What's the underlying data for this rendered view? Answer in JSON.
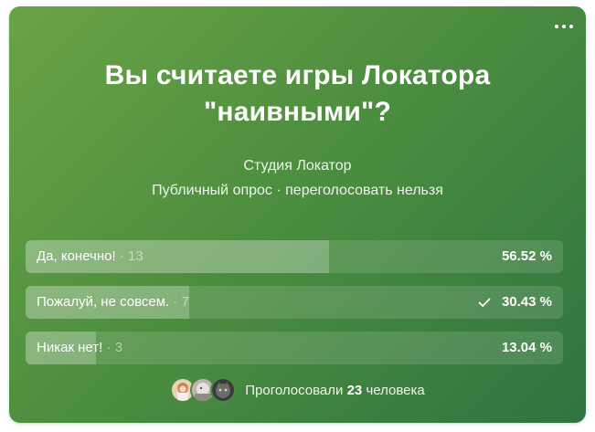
{
  "poll": {
    "title": "Вы считаете игры Локатора \"наивными\"?",
    "author": "Студия Локатор",
    "meta": "Публичный опрос · переголосовать нельзя",
    "menu_icon": "more-horizontal-icon",
    "answers": [
      {
        "label": "Да, конечно!",
        "count": "13",
        "percent_text": "56.52 %",
        "fill_fraction": 0.5652,
        "voted": false
      },
      {
        "label": "Пожалуй, не совсем.",
        "count": "7",
        "percent_text": "30.43 %",
        "fill_fraction": 0.3043,
        "voted": true
      },
      {
        "label": "Никак нет!",
        "count": "3",
        "percent_text": "13.04 %",
        "fill_fraction": 0.1304,
        "voted": false
      }
    ],
    "footer": {
      "prefix": "Проголосовали",
      "count": "23",
      "suffix": "человека"
    },
    "colors": {
      "gradient_start": "#6aa346",
      "gradient_end": "#2f7440"
    }
  }
}
